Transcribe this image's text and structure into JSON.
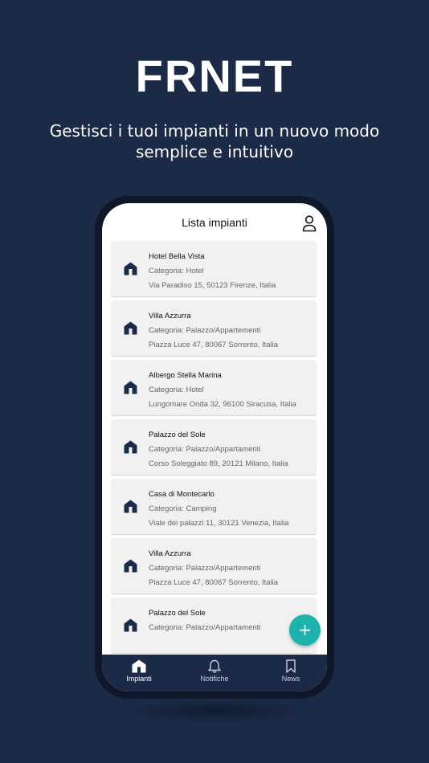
{
  "hero": {
    "title": "FRNET",
    "subtitle_line1": "Gestisci i tuoi impianti in un nuovo modo",
    "subtitle_line2": "semplice e intuitivo"
  },
  "app": {
    "header_title": "Lista impianti",
    "profile_icon": "user-icon",
    "item_icon": "house-icon",
    "accent_color": "#1db3ac",
    "nav_color": "#1b2a47"
  },
  "plants": [
    {
      "name": "Hotel Bella Vista",
      "category": "Categoria: Hotel",
      "address": "Via Paradiso 15, 50123 Firenze, Italia"
    },
    {
      "name": "Villa Azzurra",
      "category": "Categoria: Palazzo/Appartementi",
      "address": "Piazza Luce 47, 80067 Sorrento, Italia"
    },
    {
      "name": "Albergo Stella Marina",
      "category": "Categoria: Hotel",
      "address": "Lungomare Onda 32, 96100 Siracusa, Italia"
    },
    {
      "name": "Palazzo del Sole",
      "category": "Categoria: Palazzo/Appartamenti",
      "address": "Corso Soleggiato 89, 20121 Milano, Italia"
    },
    {
      "name": "Casa di Montecarlo",
      "category": "Categoria: Camping",
      "address": "Viale dei palazzi 11, 30121 Venezia, Italia"
    },
    {
      "name": "Villa Azzurra",
      "category": "Categoria: Palazzo/Appartementi",
      "address": "Piazza Luce 47, 80067 Sorrento, Italia"
    },
    {
      "name": "Palazzo del Sole",
      "category": "Categoria: Palazzo/Appartamenti",
      "address": ""
    }
  ],
  "fab": {
    "symbol": "+",
    "icon": "plus-icon"
  },
  "nav": [
    {
      "label": "Impianti",
      "icon": "house-icon",
      "active": true
    },
    {
      "label": "Notifiche",
      "icon": "bell-icon",
      "active": false
    },
    {
      "label": "News",
      "icon": "bookmark-icon",
      "active": false
    }
  ]
}
